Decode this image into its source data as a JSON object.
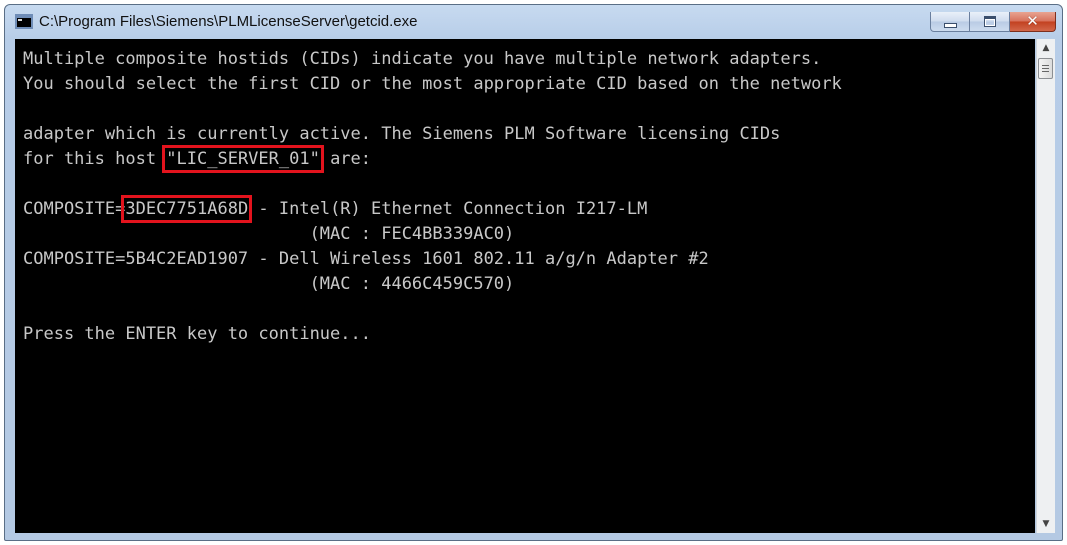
{
  "window": {
    "title": "C:\\Program Files\\Siemens\\PLMLicenseServer\\getcid.exe",
    "icon": "console-app-icon",
    "controls": {
      "minimize": "minimize-icon",
      "maximize": "maximize-icon",
      "close": "✕"
    }
  },
  "console": {
    "lines": [
      {
        "pre": "Multiple composite hostids (CIDs) indicate you have multiple network adapters.",
        "hl": "",
        "post": ""
      },
      {
        "pre": "You should select the first CID or the most appropriate CID based on the network",
        "hl": "",
        "post": ""
      },
      {
        "pre": "",
        "hl": "",
        "post": ""
      },
      {
        "pre": "adapter which is currently active. The Siemens PLM Software licensing CIDs",
        "hl": "",
        "post": ""
      },
      {
        "pre": "for this host ",
        "hl": "\"LIC_SERVER_01\"",
        "post": " are:"
      },
      {
        "pre": "",
        "hl": "",
        "post": ""
      },
      {
        "pre": "COMPOSITE=",
        "hl": "3DEC7751A68D",
        "post": " - Intel(R) Ethernet Connection I217-LM"
      },
      {
        "pre": "                            (MAC : FEC4BB339AC0)",
        "hl": "",
        "post": ""
      },
      {
        "pre": "COMPOSITE=5B4C2EAD1907 - Dell Wireless 1601 802.11 a/g/n Adapter #2",
        "hl": "",
        "post": ""
      },
      {
        "pre": "                            (MAC : 4466C459C570)",
        "hl": "",
        "post": ""
      },
      {
        "pre": "",
        "hl": "",
        "post": ""
      },
      {
        "pre": "Press the ENTER key to continue...",
        "hl": "",
        "post": ""
      }
    ]
  },
  "scrollbar": {
    "up_arrow": "▲",
    "down_arrow": "▼"
  },
  "colors": {
    "console_bg": "#000000",
    "console_text": "#c8c8c8",
    "highlight_box": "#e3131d"
  }
}
